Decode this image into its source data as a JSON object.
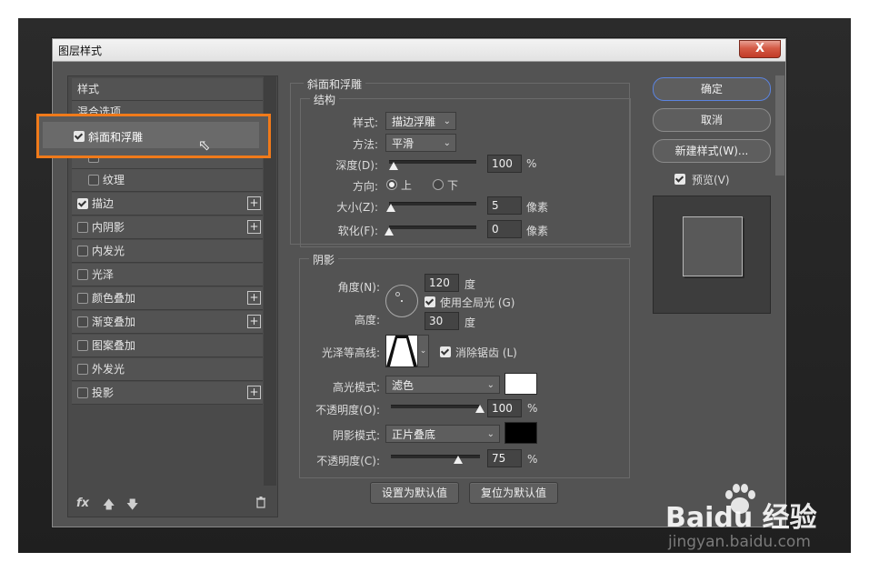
{
  "dialog": {
    "title": "图层样式",
    "close_label": "X"
  },
  "left_list": {
    "header_style": "样式",
    "header_blend": "混合选项",
    "selected_item": "斜面和浮雕",
    "items": [
      {
        "label": "纹理",
        "checked": false,
        "sub": true,
        "plus": false
      },
      {
        "label": "描边",
        "checked": true,
        "sub": false,
        "plus": true
      },
      {
        "label": "内阴影",
        "checked": false,
        "sub": false,
        "plus": true
      },
      {
        "label": "内发光",
        "checked": false,
        "sub": false,
        "plus": false
      },
      {
        "label": "光泽",
        "checked": false,
        "sub": false,
        "plus": false
      },
      {
        "label": "颜色叠加",
        "checked": false,
        "sub": false,
        "plus": true
      },
      {
        "label": "渐变叠加",
        "checked": false,
        "sub": false,
        "plus": true
      },
      {
        "label": "图案叠加",
        "checked": false,
        "sub": false,
        "plus": false
      },
      {
        "label": "外发光",
        "checked": false,
        "sub": false,
        "plus": false
      },
      {
        "label": "投影",
        "checked": false,
        "sub": false,
        "plus": true
      }
    ],
    "fx_label": "fx",
    "trash_icon": "trash-icon"
  },
  "bevel": {
    "group_title": "斜面和浮雕",
    "structure_title": "结构",
    "style_label": "样式:",
    "style_value": "描边浮雕",
    "technique_label": "方法:",
    "technique_value": "平滑",
    "depth_label": "深度(D):",
    "depth_value": "100",
    "depth_unit": "%",
    "depth_level": 0.05,
    "direction_label": "方向:",
    "dir_up": "上",
    "dir_down": "下",
    "size_label": "大小(Z):",
    "size_value": "5",
    "size_unit": "像素",
    "size_level": 0.02,
    "soften_label": "软化(F):",
    "soften_value": "0",
    "soften_unit": "像素",
    "soften_level": 0
  },
  "shading": {
    "group_title": "阴影",
    "angle_label": "角度(N):",
    "angle_value": "120",
    "angle_unit": "度",
    "global_light_label": "使用全局光 (G)",
    "altitude_label": "高度:",
    "altitude_value": "30",
    "altitude_unit": "度",
    "gloss_label": "光泽等高线:",
    "antialias_label": "消除锯齿 (L)",
    "highlight_mode_label": "高光模式:",
    "highlight_mode_value": "滤色",
    "highlight_color": "#ffffff",
    "highlight_opacity_label": "不透明度(O):",
    "highlight_opacity_value": "100",
    "highlight_opacity_level": 1.0,
    "shadow_mode_label": "阴影模式:",
    "shadow_mode_value": "正片叠底",
    "shadow_color": "#000000",
    "shadow_opacity_label": "不透明度(C):",
    "shadow_opacity_value": "75",
    "shadow_opacity_level": 0.75,
    "pct": "%"
  },
  "bottom_buttons": {
    "set_default": "设置为默认值",
    "reset_default": "复位为默认值"
  },
  "right": {
    "ok": "确定",
    "cancel": "取消",
    "new_style": "新建样式(W)...",
    "preview_label": "预览(V)"
  },
  "watermark": {
    "logo_left": "Bai",
    "logo_right": "du 经验",
    "url": "jingyan.baidu.com"
  },
  "colors": {
    "accent_orange": "#f07a1a",
    "ok_border": "#5b84e0"
  }
}
